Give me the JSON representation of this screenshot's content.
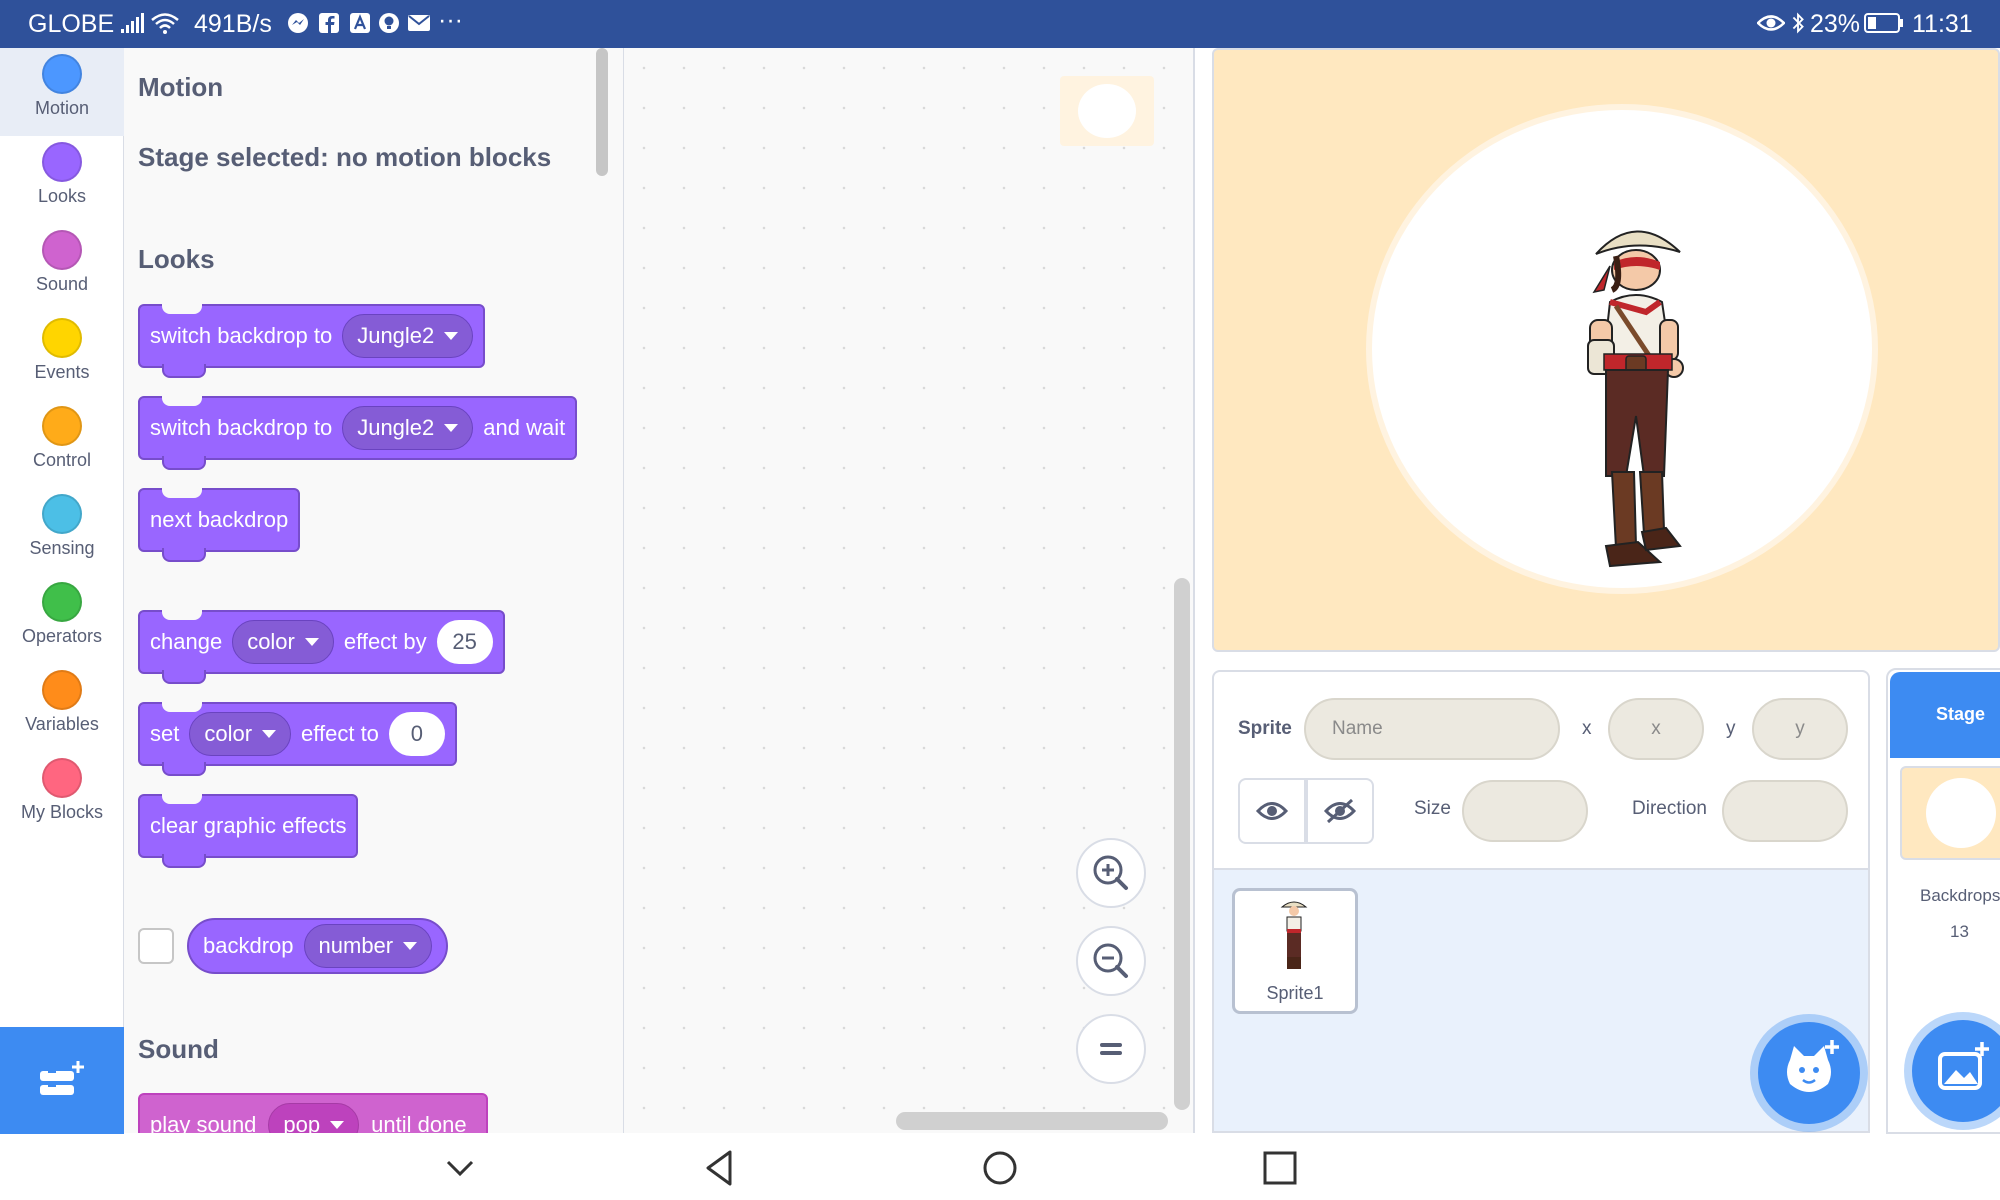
{
  "status_bar": {
    "carrier": "GLOBE",
    "net_speed": "491B/s",
    "battery": "23%",
    "time": "11:31",
    "more": "···"
  },
  "categories": [
    {
      "label": "Motion",
      "color": "#4c97ff"
    },
    {
      "label": "Looks",
      "color": "#9966ff"
    },
    {
      "label": "Sound",
      "color": "#cf63cf"
    },
    {
      "label": "Events",
      "color": "#ffd500"
    },
    {
      "label": "Control",
      "color": "#ffab19"
    },
    {
      "label": "Sensing",
      "color": "#4cbfe6"
    },
    {
      "label": "Operators",
      "color": "#40bf4a"
    },
    {
      "label": "Variables",
      "color": "#ff8c1a"
    },
    {
      "label": "My Blocks",
      "color": "#ff6680"
    }
  ],
  "palette": {
    "motion_heading": "Motion",
    "motion_note": "Stage selected: no motion blocks",
    "looks_heading": "Looks",
    "sound_heading": "Sound",
    "blocks": {
      "switch_backdrop": {
        "text": "switch backdrop to",
        "menu": "Jungle2"
      },
      "switch_backdrop_wait": {
        "text": "switch backdrop to",
        "menu": "Jungle2",
        "suffix": "and wait"
      },
      "next_backdrop": {
        "text": "next backdrop"
      },
      "change_effect": {
        "text": "change",
        "menu": "color",
        "mid": "effect by",
        "value": "25"
      },
      "set_effect": {
        "text": "set",
        "menu": "color",
        "mid": "effect to",
        "value": "0"
      },
      "clear_effects": {
        "text": "clear graphic effects"
      },
      "backdrop_reporter": {
        "text": "backdrop",
        "menu": "number"
      },
      "play_sound": {
        "text": "play sound",
        "menu": "pop",
        "suffix": "until done"
      }
    }
  },
  "sprite_info": {
    "sprite_label": "Sprite",
    "name_placeholder": "Name",
    "x_label": "x",
    "x_placeholder": "x",
    "y_label": "y",
    "y_placeholder": "y",
    "size_label": "Size",
    "direction_label": "Direction"
  },
  "sprites": [
    {
      "name": "Sprite1"
    }
  ],
  "stage_pane": {
    "title": "Stage",
    "backdrops_label": "Backdrops",
    "backdrops_count": "13"
  },
  "colors": {
    "status_bar": "#2f519a",
    "accent": "#3d8bf2",
    "looks": "#9966ff",
    "stage_bg": "#ffe8c0"
  }
}
